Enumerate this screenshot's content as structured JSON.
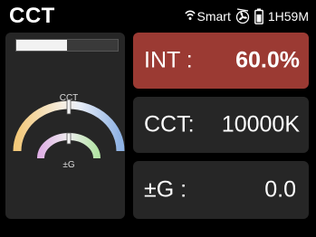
{
  "header": {
    "mode": "CCT",
    "smart_label": "Smart",
    "battery_time": "1H59M",
    "icons": [
      "smart-wireless-icon",
      "fan-icon",
      "battery-icon"
    ]
  },
  "intensity": {
    "label": "INT :",
    "value": "60.0%",
    "level_fraction": 0.5
  },
  "cct": {
    "label": "CCT:",
    "value": "10000K"
  },
  "gm": {
    "label": "±G :",
    "value": "0.0"
  },
  "gauge": {
    "outer_label": "CCT",
    "inner_label": "±G",
    "cct_marker_fraction": 0.5,
    "g_marker_fraction": 0.5
  },
  "colors": {
    "active_panel": "#9b3a33",
    "panel": "#262626",
    "background": "#000000"
  }
}
